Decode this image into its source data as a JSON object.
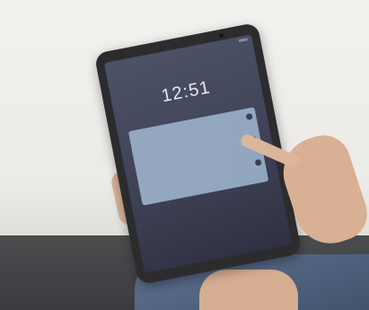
{
  "scene": {
    "description_visible": "",
    "tablet": {
      "time": "12:51"
    }
  }
}
